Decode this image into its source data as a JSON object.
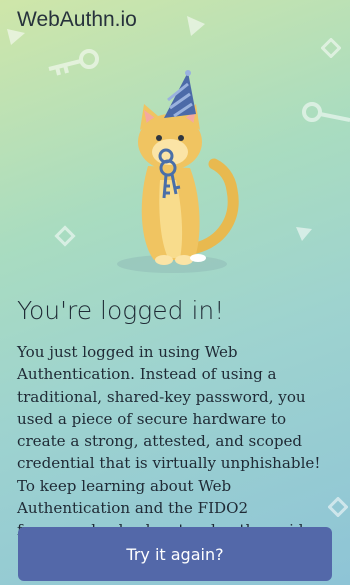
{
  "header": {
    "brand": "WebAuthn.io"
  },
  "hero": {
    "image": "cat-with-keys-illustration"
  },
  "main": {
    "title": "You're logged in!",
    "description_text": "You just logged in using Web Authentication. Instead of using a traditional, shared-key password, you used a piece of secure hardware to create a strong, attested, and scoped credential that is virtually unphishable! To keep learning about Web Authentication and the FIDO2 framework, check out ",
    "link_label": "webauthn.guide",
    "description_end": ".",
    "button_label": "Try it again?"
  },
  "colors": {
    "button": "#5368a9",
    "background_start": "#cfe6a9",
    "background_end": "#8ec4d6"
  }
}
